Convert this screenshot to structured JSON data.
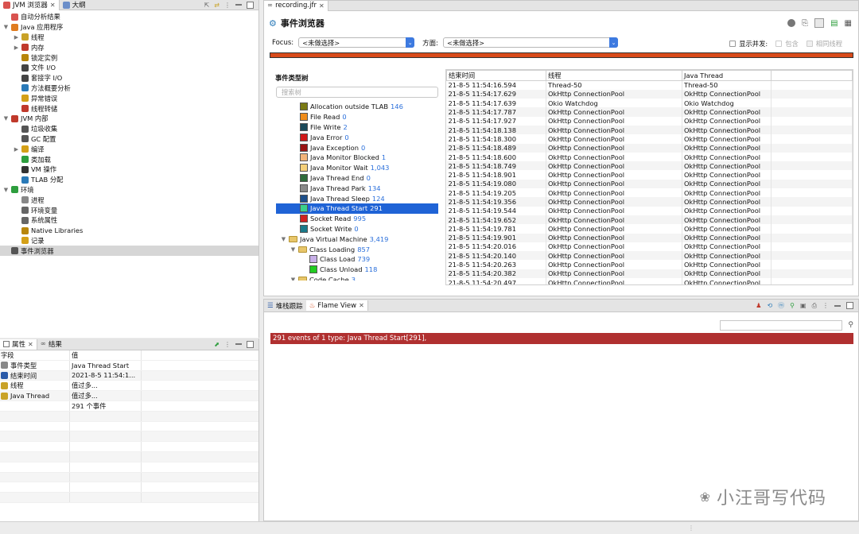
{
  "left_tabs": [
    {
      "label": "JVM 浏览器"
    },
    {
      "label": "大纲"
    }
  ],
  "tree": [
    {
      "label": "自动分析结果",
      "indent": 0,
      "twisty": "",
      "color": "#d9534f"
    },
    {
      "label": "Java 应用程序",
      "indent": 0,
      "twisty": "▼",
      "color": "#e07b1f"
    },
    {
      "label": "线程",
      "indent": 1,
      "twisty": "▶",
      "color": "#c9a227"
    },
    {
      "label": "内存",
      "indent": 1,
      "twisty": "▶",
      "color": "#c0392b"
    },
    {
      "label": "锁定实例",
      "indent": 1,
      "twisty": "",
      "color": "#b8860b"
    },
    {
      "label": "文件 I/O",
      "indent": 1,
      "twisty": "",
      "color": "#444"
    },
    {
      "label": "套接字 I/O",
      "indent": 1,
      "twisty": "",
      "color": "#444"
    },
    {
      "label": "方法概要分析",
      "indent": 1,
      "twisty": "",
      "color": "#2a7ab8"
    },
    {
      "label": "异常错误",
      "indent": 1,
      "twisty": "",
      "color": "#d4a017"
    },
    {
      "label": "线程转储",
      "indent": 1,
      "twisty": "",
      "color": "#c0392b"
    },
    {
      "label": "JVM 内部",
      "indent": 0,
      "twisty": "▼",
      "color": "#c0392b"
    },
    {
      "label": "垃圾收集",
      "indent": 1,
      "twisty": "",
      "color": "#555"
    },
    {
      "label": "GC 配置",
      "indent": 1,
      "twisty": "",
      "color": "#555"
    },
    {
      "label": "编译",
      "indent": 1,
      "twisty": "▶",
      "color": "#d4a017"
    },
    {
      "label": "类加载",
      "indent": 1,
      "twisty": "",
      "color": "#2e9e3e"
    },
    {
      "label": "VM 操作",
      "indent": 1,
      "twisty": "",
      "color": "#333"
    },
    {
      "label": "TLAB 分配",
      "indent": 1,
      "twisty": "",
      "color": "#2a7ab8"
    },
    {
      "label": "环境",
      "indent": 0,
      "twisty": "▼",
      "color": "#2e9e3e"
    },
    {
      "label": "进程",
      "indent": 1,
      "twisty": "",
      "color": "#888"
    },
    {
      "label": "环境变量",
      "indent": 1,
      "twisty": "",
      "color": "#666"
    },
    {
      "label": "系统属性",
      "indent": 1,
      "twisty": "",
      "color": "#666"
    },
    {
      "label": "Native Libraries",
      "indent": 1,
      "twisty": "",
      "color": "#b8860b"
    },
    {
      "label": "记录",
      "indent": 1,
      "twisty": "",
      "color": "#d4a017"
    },
    {
      "label": "事件浏览器",
      "indent": 0,
      "twisty": "",
      "color": "#555",
      "selected": true
    }
  ],
  "props_tabs": [
    {
      "label": "属性"
    },
    {
      "label": "结果"
    }
  ],
  "props_header": {
    "field": "字段",
    "value": "值"
  },
  "props": [
    {
      "field": "事件类型",
      "value": "Java Thread Start"
    },
    {
      "field": "结束时间",
      "value": "2021-8-5 11:54:1..."
    },
    {
      "field": "线程",
      "value": "值过多..."
    },
    {
      "field": "Java Thread",
      "value": "值过多..."
    },
    {
      "field": "",
      "value": "291 个事件"
    }
  ],
  "editor_tab": "recording.jfr",
  "editor_title": "事件浏览器",
  "focus_label": "Focus:",
  "focus_value": "<未做选择>",
  "aspect_label": "方面:",
  "aspect_value": "<未做选择>",
  "show_concurrent": "显示并发:",
  "contains": "包含",
  "same_thread": "相同线程",
  "event_tree_title": "事件类型树",
  "search_placeholder": "搜索树",
  "event_types": [
    {
      "name": "Allocation outside TLAB",
      "count": "146",
      "color": "#7a7a14",
      "indent": 2,
      "kind": "leaf"
    },
    {
      "name": "File Read",
      "count": "0",
      "color": "#f08c1a",
      "indent": 2,
      "kind": "leaf"
    },
    {
      "name": "File Write",
      "count": "2",
      "color": "#1b4a5a",
      "indent": 2,
      "kind": "leaf"
    },
    {
      "name": "Java Error",
      "count": "0",
      "color": "#d01818",
      "indent": 2,
      "kind": "leaf"
    },
    {
      "name": "Java Exception",
      "count": "0",
      "color": "#9a1414",
      "indent": 2,
      "kind": "leaf"
    },
    {
      "name": "Java Monitor Blocked",
      "count": "1",
      "color": "#f2b47a",
      "indent": 2,
      "kind": "leaf"
    },
    {
      "name": "Java Monitor Wait",
      "count": "1,043",
      "color": "#f5d07a",
      "indent": 2,
      "kind": "leaf"
    },
    {
      "name": "Java Thread End",
      "count": "0",
      "color": "#2e6b3a",
      "indent": 2,
      "kind": "leaf"
    },
    {
      "name": "Java Thread Park",
      "count": "134",
      "color": "#8a8a8a",
      "indent": 2,
      "kind": "leaf"
    },
    {
      "name": "Java Thread Sleep",
      "count": "124",
      "color": "#1d4f8a",
      "indent": 2,
      "kind": "leaf"
    },
    {
      "name": "Java Thread Start",
      "count": "291",
      "color": "#3ad08a",
      "indent": 2,
      "kind": "leaf",
      "selected": true
    },
    {
      "name": "Socket Read",
      "count": "995",
      "color": "#d02020",
      "indent": 2,
      "kind": "leaf"
    },
    {
      "name": "Socket Write",
      "count": "0",
      "color": "#1a7a8a",
      "indent": 2,
      "kind": "leaf"
    },
    {
      "name": "Java Virtual Machine",
      "count": "3,419",
      "color": "",
      "indent": 0,
      "kind": "folder"
    },
    {
      "name": "Class Loading",
      "count": "857",
      "color": "",
      "indent": 1,
      "kind": "folder"
    },
    {
      "name": "Class Load",
      "count": "739",
      "color": "#c8b0e8",
      "indent": 3,
      "kind": "leaf"
    },
    {
      "name": "Class Unload",
      "count": "118",
      "color": "#22cc22",
      "indent": 3,
      "kind": "leaf"
    },
    {
      "name": "Code Cache",
      "count": "3",
      "color": "",
      "indent": 1,
      "kind": "folder"
    }
  ],
  "events_table": {
    "headers": [
      "结束时间",
      "线程",
      "Java Thread"
    ],
    "rows": [
      [
        "21-8-5 11:54:16.594",
        "Thread-50",
        "Thread-50"
      ],
      [
        "21-8-5 11:54:17.629",
        "OkHttp ConnectionPool",
        "OkHttp ConnectionPool"
      ],
      [
        "21-8-5 11:54:17.639",
        "Okio Watchdog",
        "Okio Watchdog"
      ],
      [
        "21-8-5 11:54:17.787",
        "OkHttp ConnectionPool",
        "OkHttp ConnectionPool"
      ],
      [
        "21-8-5 11:54:17.927",
        "OkHttp ConnectionPool",
        "OkHttp ConnectionPool"
      ],
      [
        "21-8-5 11:54:18.138",
        "OkHttp ConnectionPool",
        "OkHttp ConnectionPool"
      ],
      [
        "21-8-5 11:54:18.300",
        "OkHttp ConnectionPool",
        "OkHttp ConnectionPool"
      ],
      [
        "21-8-5 11:54:18.489",
        "OkHttp ConnectionPool",
        "OkHttp ConnectionPool"
      ],
      [
        "21-8-5 11:54:18.600",
        "OkHttp ConnectionPool",
        "OkHttp ConnectionPool"
      ],
      [
        "21-8-5 11:54:18.749",
        "OkHttp ConnectionPool",
        "OkHttp ConnectionPool"
      ],
      [
        "21-8-5 11:54:18.901",
        "OkHttp ConnectionPool",
        "OkHttp ConnectionPool"
      ],
      [
        "21-8-5 11:54:19.080",
        "OkHttp ConnectionPool",
        "OkHttp ConnectionPool"
      ],
      [
        "21-8-5 11:54:19.205",
        "OkHttp ConnectionPool",
        "OkHttp ConnectionPool"
      ],
      [
        "21-8-5 11:54:19.356",
        "OkHttp ConnectionPool",
        "OkHttp ConnectionPool"
      ],
      [
        "21-8-5 11:54:19.544",
        "OkHttp ConnectionPool",
        "OkHttp ConnectionPool"
      ],
      [
        "21-8-5 11:54:19.652",
        "OkHttp ConnectionPool",
        "OkHttp ConnectionPool"
      ],
      [
        "21-8-5 11:54:19.781",
        "OkHttp ConnectionPool",
        "OkHttp ConnectionPool"
      ],
      [
        "21-8-5 11:54:19.901",
        "OkHttp ConnectionPool",
        "OkHttp ConnectionPool"
      ],
      [
        "21-8-5 11:54:20.016",
        "OkHttp ConnectionPool",
        "OkHttp ConnectionPool"
      ],
      [
        "21-8-5 11:54:20.140",
        "OkHttp ConnectionPool",
        "OkHttp ConnectionPool"
      ],
      [
        "21-8-5 11:54:20.263",
        "OkHttp ConnectionPool",
        "OkHttp ConnectionPool"
      ],
      [
        "21-8-5 11:54:20.382",
        "OkHttp ConnectionPool",
        "OkHttp ConnectionPool"
      ],
      [
        "21-8-5 11:54:20.497",
        "OkHttp ConnectionPool",
        "OkHttp ConnectionPool"
      ]
    ]
  },
  "bottom_tabs": [
    {
      "label": "堆栈跟踪"
    },
    {
      "label": "Flame View"
    }
  ],
  "flame_banner": "291 events of 1 type: Java Thread Start[291],",
  "watermark": "小汪哥写代码",
  "colors": {
    "selection": "#1f63d6",
    "flame_bar": "#b03030",
    "progress": "#d84a1a"
  }
}
